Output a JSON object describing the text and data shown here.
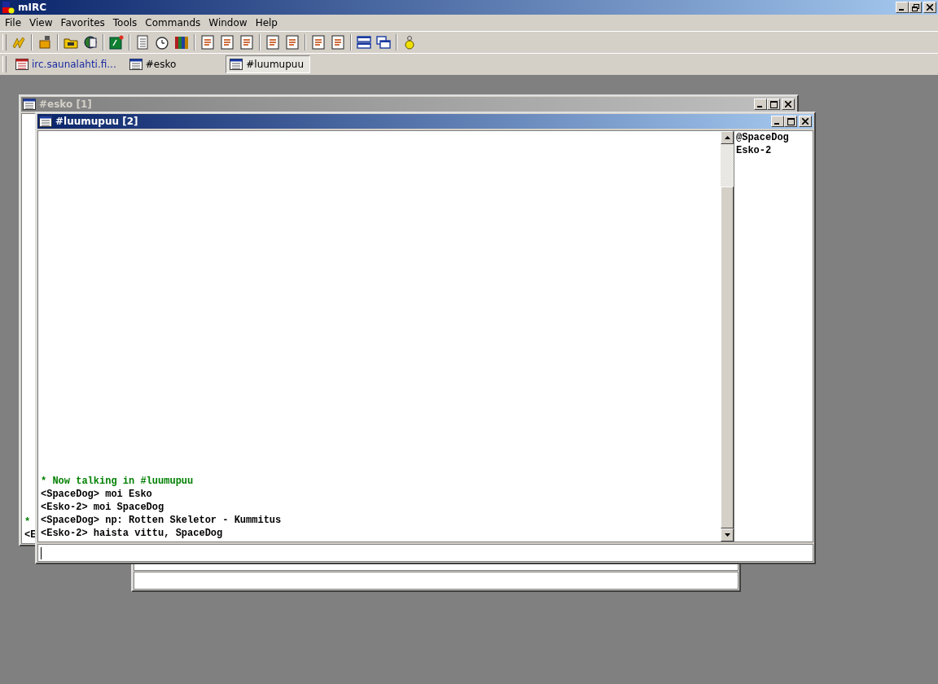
{
  "app": {
    "title": "mIRC"
  },
  "menu": [
    "File",
    "View",
    "Favorites",
    "Tools",
    "Commands",
    "Window",
    "Help"
  ],
  "switchbar": [
    {
      "label": "irc.saunalahti.fi...",
      "kind": "server",
      "selected": false
    },
    {
      "label": "#esko",
      "kind": "channel",
      "selected": false
    },
    {
      "label": "#luumupuu",
      "kind": "channel",
      "selected": true
    }
  ],
  "windows": [
    {
      "title": "#esko [1]",
      "active": false,
      "lines": [
        {
          "text": "*",
          "kind": "event"
        },
        {
          "text": "<E",
          "kind": "message"
        }
      ]
    },
    {
      "title": "#luumupuu [2]",
      "active": true,
      "lines": [
        {
          "text": "* Now talking in #luumupuu",
          "kind": "event"
        },
        {
          "text": "<SpaceDog> moi Esko",
          "kind": "message"
        },
        {
          "text": "<Esko-2> moi SpaceDog",
          "kind": "message"
        },
        {
          "text": "<SpaceDog> np: Rotten Skeletor - Kummitus",
          "kind": "message"
        },
        {
          "text": "<Esko-2> haista vittu, SpaceDog",
          "kind": "message"
        }
      ],
      "nicks": [
        "@SpaceDog",
        "Esko-2"
      ]
    }
  ]
}
